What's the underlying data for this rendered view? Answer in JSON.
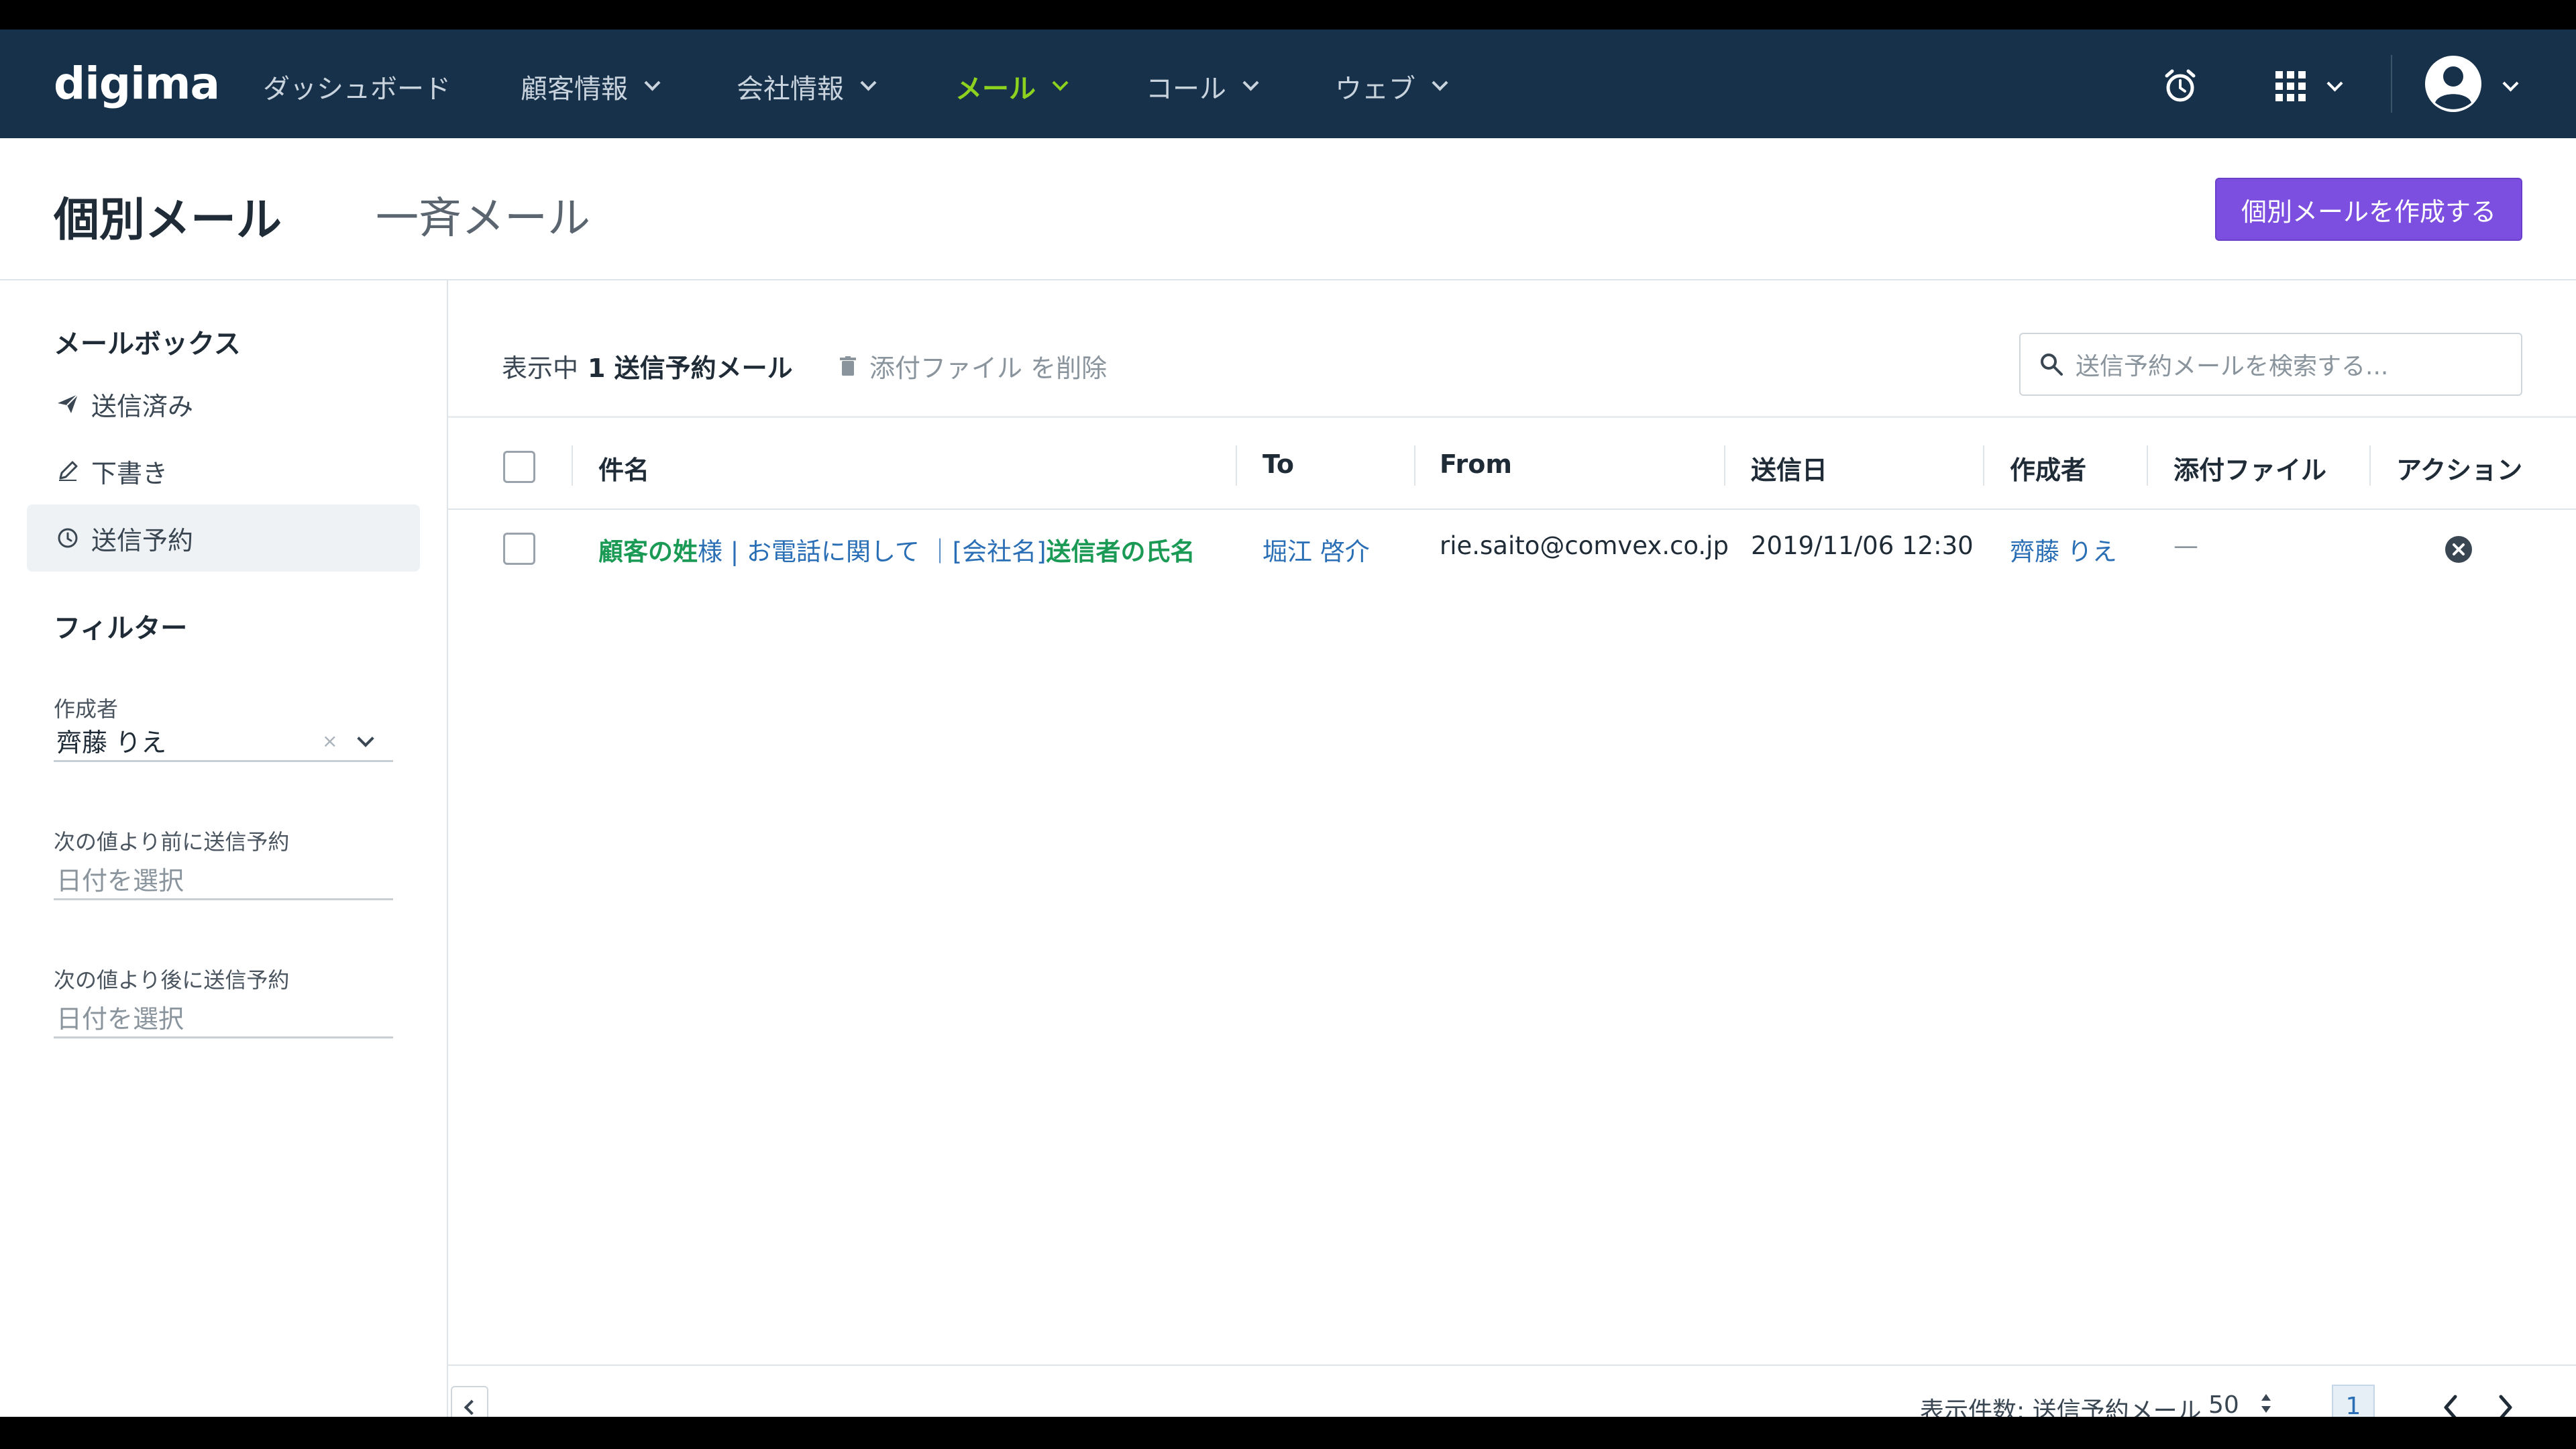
{
  "nav": {
    "logo": "digima",
    "items": [
      {
        "label": "ダッシュボード",
        "has_menu": false,
        "active": false
      },
      {
        "label": "顧客情報",
        "has_menu": true,
        "active": false
      },
      {
        "label": "会社情報",
        "has_menu": true,
        "active": false
      },
      {
        "label": "メール",
        "has_menu": true,
        "active": true
      },
      {
        "label": "コール",
        "has_menu": true,
        "active": false
      },
      {
        "label": "ウェブ",
        "has_menu": true,
        "active": false
      }
    ],
    "icons": [
      "alarm-clock-icon",
      "apps-grid-icon",
      "user-avatar-icon"
    ]
  },
  "header": {
    "tab_active": "個別メール",
    "tab_other": "一斉メール",
    "create_button": "個別メールを作成する"
  },
  "sidebar": {
    "mailbox_heading": "メールボックス",
    "items": [
      {
        "label": "送信済み",
        "icon": "paper-plane-icon",
        "active": false
      },
      {
        "label": "下書き",
        "icon": "pencil-icon",
        "active": false
      },
      {
        "label": "送信予約",
        "icon": "clock-icon",
        "active": true
      }
    ],
    "filter_heading": "フィルター",
    "filters": [
      {
        "label": "作成者",
        "value": "齊藤 りえ",
        "clear": "×"
      },
      {
        "label": "次の値より前に送信予約",
        "placeholder": "日付を選択"
      },
      {
        "label": "次の値より後に送信予約",
        "placeholder": "日付を選択"
      }
    ]
  },
  "toolbar": {
    "showing_prefix": "表示中",
    "showing_count": "1 送信予約メール",
    "delete_attachments": "添付ファイル を削除",
    "search_placeholder": "送信予約メールを検索する..."
  },
  "table": {
    "headers": [
      "件名",
      "To",
      "From",
      "送信日",
      "作成者",
      "添付ファイル",
      "アクション"
    ],
    "rows": [
      {
        "subject_parts": [
          {
            "text": "顧客の姓",
            "style": "g"
          },
          {
            "text": "様 | お電話に関して ｜[会社名]",
            "style": "b"
          },
          {
            "text": "送信者の氏名",
            "style": "g"
          }
        ],
        "to": "堀江 啓介",
        "from": "rie.saito@comvex.co.jp",
        "date": "2019/11/06 12:30",
        "author": "齊藤 りえ",
        "attachment": "—"
      }
    ]
  },
  "footer": {
    "per_page_label": "表示件数: 送信予約メール",
    "per_page_value": "50",
    "page": "1"
  },
  "colors": {
    "nav_bg": "#163149",
    "accent_green": "#8cd21f",
    "button_purple": "#7c4fe0",
    "link_blue": "#2a6fb5",
    "subject_green": "#1a9a55"
  }
}
